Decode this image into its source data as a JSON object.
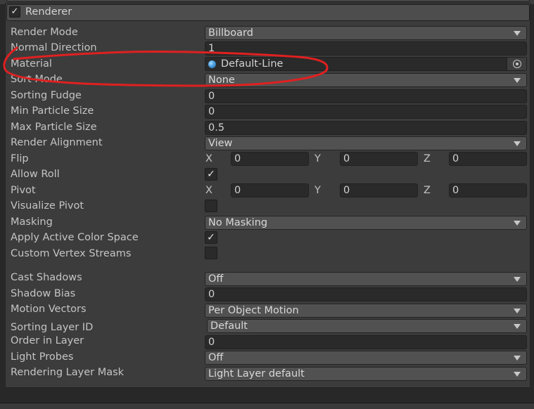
{
  "module": {
    "title": "Renderer",
    "enabled": true
  },
  "rows": {
    "render_mode": {
      "label": "Render Mode",
      "value": "Billboard"
    },
    "normal_direction": {
      "label": "Normal Direction",
      "value": "1"
    },
    "material": {
      "label": "Material",
      "value": "Default-Line"
    },
    "sort_mode": {
      "label": "Sort Mode",
      "value": "None"
    },
    "sorting_fudge": {
      "label": "Sorting Fudge",
      "value": "0"
    },
    "min_particle_size": {
      "label": "Min Particle Size",
      "value": "0"
    },
    "max_particle_size": {
      "label": "Max Particle Size",
      "value": "0.5"
    },
    "render_alignment": {
      "label": "Render Alignment",
      "value": "View"
    },
    "flip": {
      "label": "Flip",
      "x": "0",
      "y": "0",
      "z": "0"
    },
    "allow_roll": {
      "label": "Allow Roll",
      "checked": true
    },
    "pivot": {
      "label": "Pivot",
      "x": "0",
      "y": "0",
      "z": "0"
    },
    "visualize_pivot": {
      "label": "Visualize Pivot",
      "checked": false
    },
    "masking": {
      "label": "Masking",
      "value": "No Masking"
    },
    "apply_active_color_space": {
      "label": "Apply Active Color Space",
      "checked": true
    },
    "custom_vertex_streams": {
      "label": "Custom Vertex Streams",
      "checked": false
    },
    "cast_shadows": {
      "label": "Cast Shadows",
      "value": "Off"
    },
    "shadow_bias": {
      "label": "Shadow Bias",
      "value": "0"
    },
    "motion_vectors": {
      "label": "Motion Vectors",
      "value": "Per Object Motion"
    },
    "sorting_layer_id": {
      "label": "Sorting Layer ID",
      "value": "Default"
    },
    "order_in_layer": {
      "label": "Order in Layer",
      "value": "0"
    },
    "light_probes": {
      "label": "Light Probes",
      "value": "Off"
    },
    "rendering_layer_mask": {
      "label": "Rendering Layer Mask",
      "value": "Light Layer default"
    }
  },
  "axes": {
    "x": "X",
    "y": "Y",
    "z": "Z"
  },
  "check_glyph": "✓",
  "icons": {
    "material": "material-sphere-icon",
    "picker": "object-picker-icon",
    "dropdown": "caret-down-icon"
  },
  "colors": {
    "annotation": "#e02020",
    "background": "#3c3c3c",
    "field": "#2a2a2a",
    "dropdown": "#515151"
  }
}
